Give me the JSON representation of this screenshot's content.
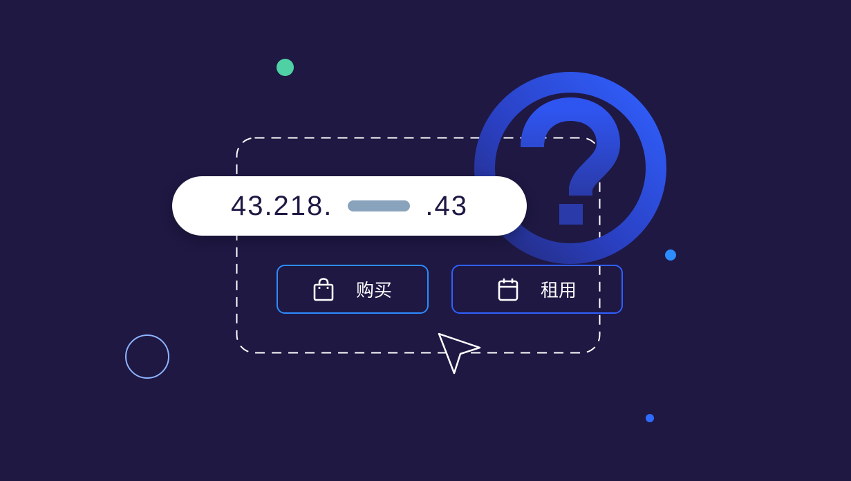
{
  "ip": {
    "prefix": "43.218.",
    "suffix": ".43"
  },
  "buttons": {
    "buy_label": "购买",
    "rent_label": "租用"
  },
  "icons": {
    "buy": "shopping-bag-icon",
    "rent": "calendar-icon",
    "badge": "question-mark-icon",
    "pointer": "mouse-cursor-icon"
  },
  "colors": {
    "background": "#1e1843",
    "accent_blue": "#2d8cff",
    "badge_blue": "#2f5bff",
    "dot_green": "#4fd1a5",
    "mask_gray": "#8aa3bc"
  }
}
